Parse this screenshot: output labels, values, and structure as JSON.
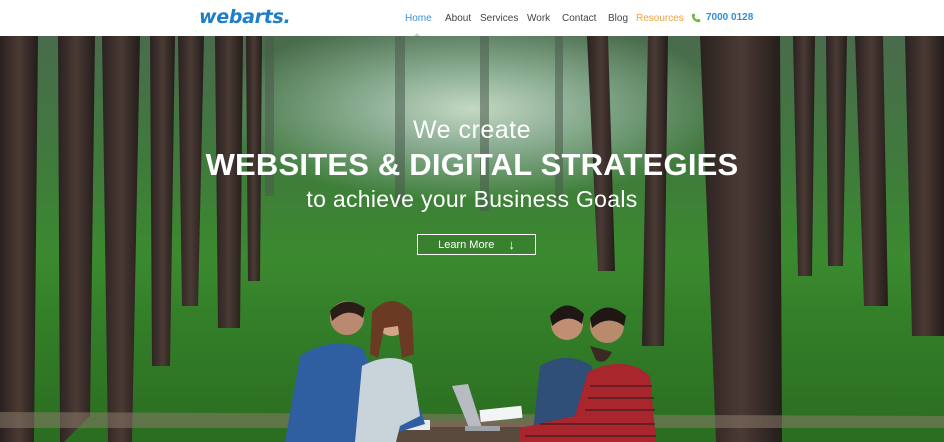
{
  "brand": {
    "name": "webarts",
    "dot": "."
  },
  "nav": {
    "items": [
      {
        "label": "Home",
        "active": true
      },
      {
        "label": "About"
      },
      {
        "label": "Services"
      },
      {
        "label": "Work"
      },
      {
        "label": "Contact"
      },
      {
        "label": "Blog"
      },
      {
        "label": "Resources",
        "highlight": true
      }
    ],
    "phone": "7000 0128"
  },
  "hero": {
    "line1": "We create",
    "line2": "WEBSITES & DIGITAL STRATEGIES",
    "line3": "to achieve your Business Goals",
    "cta_label": "Learn More",
    "cta_icon": "down-arrow-icon"
  },
  "colors": {
    "brand_blue": "#1e7ec8",
    "nav_active": "#3a8fd6",
    "resources_orange": "#f0a23b",
    "phone_blue": "#2e8fd4",
    "forest_green": "#3b8a2f"
  }
}
